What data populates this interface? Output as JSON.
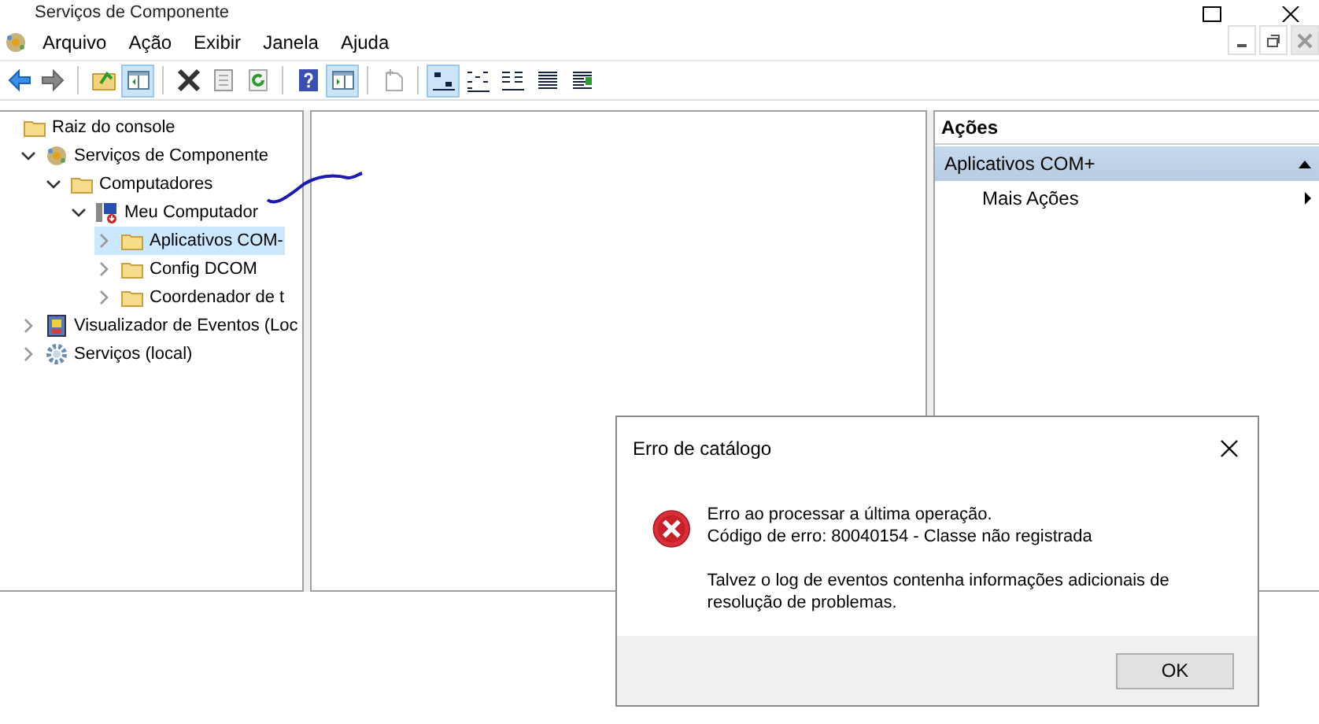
{
  "window": {
    "title": "Serviços de Componente"
  },
  "menu": [
    "Arquivo",
    "Ação",
    "Exibir",
    "Janela",
    "Ajuda"
  ],
  "toolbar": [
    [
      {
        "kind": "back",
        "pressed": false
      },
      {
        "kind": "forward",
        "pressed": false
      }
    ],
    [
      {
        "kind": "up",
        "pressed": false
      },
      {
        "kind": "tree",
        "pressed": true
      }
    ],
    [
      {
        "kind": "delete",
        "pressed": false
      },
      {
        "kind": "properties",
        "pressed": false
      },
      {
        "kind": "refresh",
        "pressed": false
      }
    ],
    [
      {
        "kind": "help",
        "pressed": false
      },
      {
        "kind": "actionpane",
        "pressed": true
      }
    ],
    [
      {
        "kind": "newitem",
        "pressed": false
      }
    ],
    [
      {
        "kind": "largeicons",
        "pressed": true
      },
      {
        "kind": "smallicons",
        "pressed": false
      },
      {
        "kind": "list",
        "pressed": false
      },
      {
        "kind": "details",
        "pressed": false
      },
      {
        "kind": "custom",
        "pressed": false
      }
    ]
  ],
  "tree": [
    {
      "label": "Raiz do console",
      "kind": "folder",
      "children": [
        {
          "label": "Serviços de Componente",
          "kind": "component",
          "expanded": true,
          "selected": false,
          "children": [
            {
              "label": "Computadores",
              "kind": "folder",
              "expanded": true,
              "selected": false,
              "children": [
                {
                  "label": "Meu Computador",
                  "kind": "computer",
                  "expanded": true,
                  "selected": false,
                  "children": [
                    {
                      "label": "Aplicativos COM-",
                      "kind": "folder",
                      "expanded": false,
                      "selected": true
                    },
                    {
                      "label": "Config DCOM",
                      "kind": "folder",
                      "expanded": false,
                      "selected": false
                    },
                    {
                      "label": "Coordenador de t",
                      "kind": "folder",
                      "expanded": false,
                      "selected": false
                    }
                  ]
                }
              ]
            }
          ]
        },
        {
          "label": "Visualizador de Eventos (Loc",
          "kind": "eventlog",
          "expanded": false,
          "selected": false
        },
        {
          "label": "Serviços (local)",
          "kind": "gear",
          "expanded": false,
          "selected": false
        }
      ]
    }
  ],
  "actions": {
    "title": "Ações",
    "sections": [
      {
        "title": "Aplicativos COM+",
        "expanded": true,
        "items": [
          "Mais Ações"
        ]
      }
    ]
  },
  "dialog": {
    "title": "Erro de catálogo",
    "lines": [
      "Erro ao processar a última operação.",
      "Código de erro: 80040154 - Classe não registrada"
    ],
    "note": "Talvez o log de eventos contenha informações adicionais de resolução de problemas.",
    "buttons": [
      "OK"
    ]
  }
}
